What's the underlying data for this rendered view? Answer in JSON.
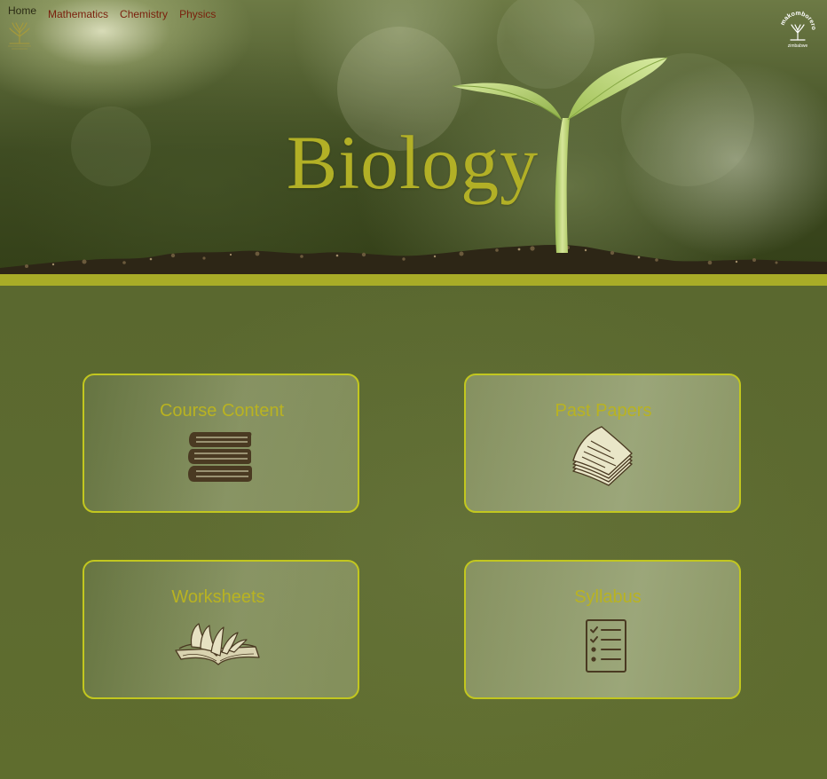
{
  "nav": {
    "items": [
      {
        "label": "Home"
      },
      {
        "label": "Mathematics"
      },
      {
        "label": "Chemistry"
      },
      {
        "label": "Physics"
      }
    ]
  },
  "hero": {
    "title": "Biology",
    "left_logo_icon": "tree-logo-icon",
    "right_logo_icon": "makomborero-logo-icon",
    "right_logo_text": "makomborero",
    "right_logo_subtext": "zimbabwe"
  },
  "cards": [
    {
      "title": "Course Content",
      "icon": "books-stack-icon"
    },
    {
      "title": "Past Papers",
      "icon": "paper-stack-icon"
    },
    {
      "title": "Worksheets",
      "icon": "open-book-icon"
    },
    {
      "title": "Syllabus",
      "icon": "checklist-icon"
    }
  ],
  "colors": {
    "accent": "#a8ac27",
    "title": "#b2b026",
    "nav_link": "#7a1f0c",
    "background": "#5a682f",
    "card_border": "#c2c71f"
  }
}
